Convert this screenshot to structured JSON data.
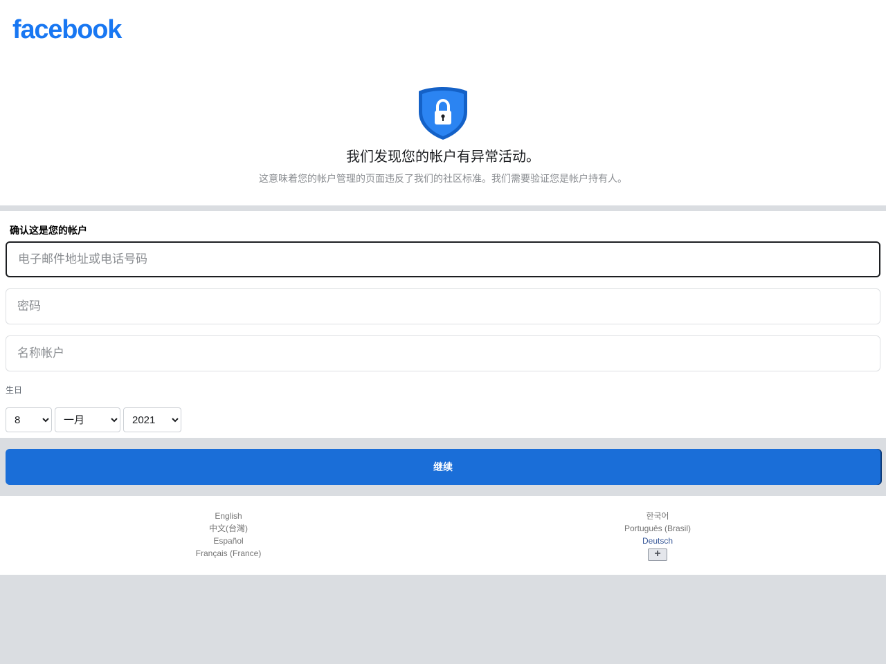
{
  "brand": {
    "logo_text": "facebook",
    "color": "#1877f2"
  },
  "alert": {
    "icon": "shield-lock-icon",
    "headline": "我们发现您的帐户有异常活动。",
    "subline": "这意味着您的帐户管理的页面违反了我们的社区标准。我们需要验证您是帐户持有人。"
  },
  "form": {
    "title": "确认这是您的帐户",
    "email_placeholder": "电子邮件地址或电话号码",
    "password_placeholder": "密码",
    "account_name_placeholder": "名称帐户",
    "birthday_label": "生日",
    "birthday": {
      "day": "8",
      "month": "一月",
      "year": "2021"
    },
    "continue_label": "继续",
    "button_color": "#1a6ed8"
  },
  "footer": {
    "left_languages": [
      "English",
      "中文(台灣)",
      "Español",
      "Français (France)"
    ],
    "right_languages": [
      "한국어",
      "Português (Brasil)",
      "Deutsch"
    ],
    "more_icon": "plus-icon",
    "more_label": "+"
  }
}
